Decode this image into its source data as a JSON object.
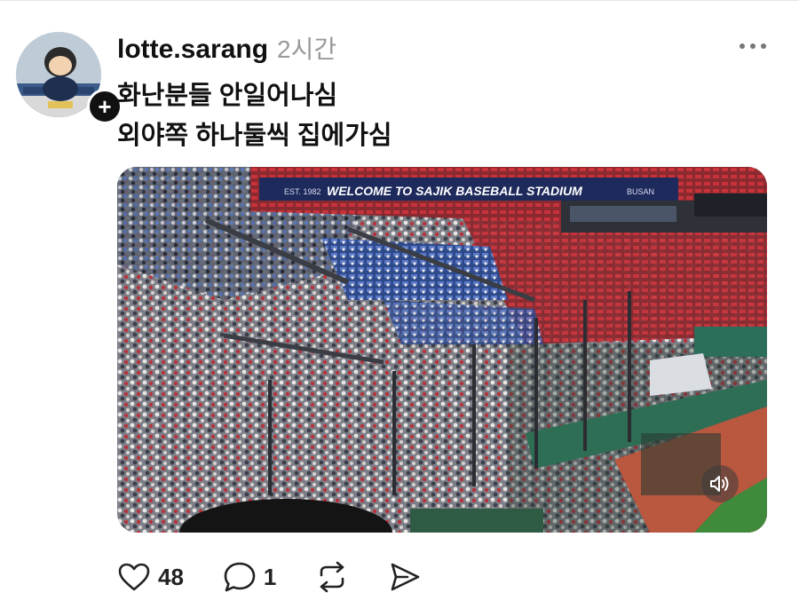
{
  "post": {
    "username": "lotte.sarang",
    "time": "2시간",
    "text_line1": "화난분들 안일어나심",
    "text_line2": "외야쪽 하나둘씩 집에가심"
  },
  "image": {
    "banner_text": "WELCOME TO SAJIK BASEBALL STADIUM",
    "banner_small_left": "EST. 1982",
    "banner_small_right": "BUSAN"
  },
  "actions": {
    "like_count": "48",
    "comment_count": "1"
  },
  "icons": {
    "follow": "plus-icon",
    "more": "more-horizontal-icon",
    "mute": "speaker-icon",
    "like": "heart-icon",
    "comment": "comment-icon",
    "repost": "repost-icon",
    "share": "send-icon"
  },
  "colors": {
    "accent_red": "#c8323a",
    "text_muted": "#9a9a9a"
  }
}
